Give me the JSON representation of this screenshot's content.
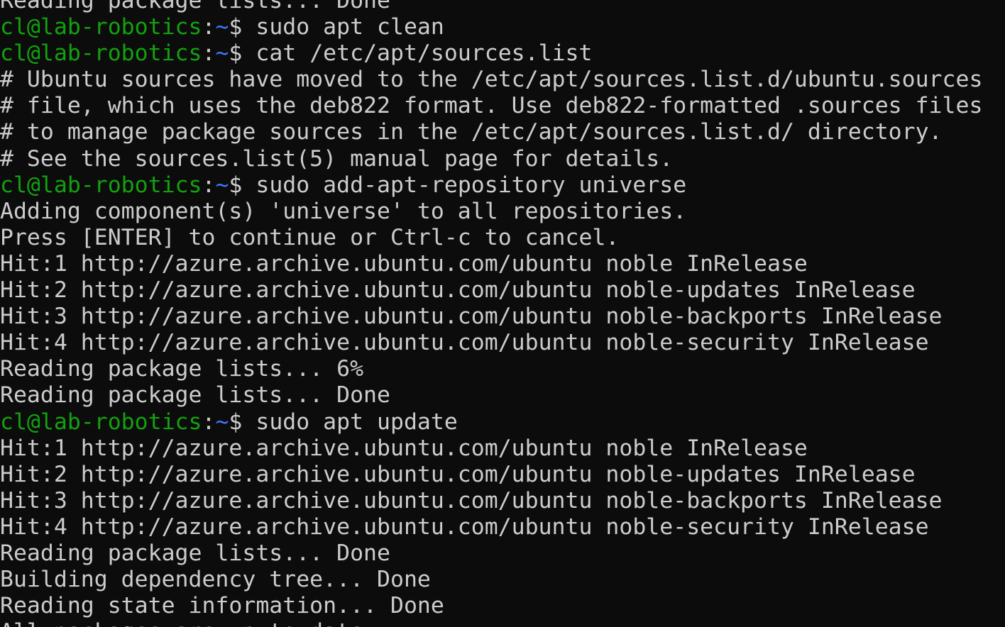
{
  "terminal": {
    "lines": [
      {
        "type": "output",
        "text": "Reading package lists... Done"
      },
      {
        "type": "prompt",
        "user_host": "cl@lab-robotics",
        "sep": ":",
        "path": "~",
        "prompt_char": "$ ",
        "command": "sudo apt clean"
      },
      {
        "type": "prompt",
        "user_host": "cl@lab-robotics",
        "sep": ":",
        "path": "~",
        "prompt_char": "$ ",
        "command": "cat /etc/apt/sources.list"
      },
      {
        "type": "output",
        "text": "# Ubuntu sources have moved to the /etc/apt/sources.list.d/ubuntu.sources"
      },
      {
        "type": "output",
        "text": "# file, which uses the deb822 format. Use deb822-formatted .sources files"
      },
      {
        "type": "output",
        "text": "# to manage package sources in the /etc/apt/sources.list.d/ directory."
      },
      {
        "type": "output",
        "text": "# See the sources.list(5) manual page for details."
      },
      {
        "type": "prompt",
        "user_host": "cl@lab-robotics",
        "sep": ":",
        "path": "~",
        "prompt_char": "$ ",
        "command": "sudo add-apt-repository universe"
      },
      {
        "type": "output",
        "text": "Adding component(s) 'universe' to all repositories."
      },
      {
        "type": "output",
        "text": "Press [ENTER] to continue or Ctrl-c to cancel."
      },
      {
        "type": "output",
        "text": "Hit:1 http://azure.archive.ubuntu.com/ubuntu noble InRelease"
      },
      {
        "type": "output",
        "text": "Hit:2 http://azure.archive.ubuntu.com/ubuntu noble-updates InRelease"
      },
      {
        "type": "output",
        "text": "Hit:3 http://azure.archive.ubuntu.com/ubuntu noble-backports InRelease"
      },
      {
        "type": "output",
        "text": "Hit:4 http://azure.archive.ubuntu.com/ubuntu noble-security InRelease"
      },
      {
        "type": "output",
        "text": "Reading package lists... 6%"
      },
      {
        "type": "output",
        "text": "Reading package lists... Done"
      },
      {
        "type": "prompt",
        "user_host": "cl@lab-robotics",
        "sep": ":",
        "path": "~",
        "prompt_char": "$ ",
        "command": "sudo apt update"
      },
      {
        "type": "output",
        "text": "Hit:1 http://azure.archive.ubuntu.com/ubuntu noble InRelease"
      },
      {
        "type": "output",
        "text": "Hit:2 http://azure.archive.ubuntu.com/ubuntu noble-updates InRelease"
      },
      {
        "type": "output",
        "text": "Hit:3 http://azure.archive.ubuntu.com/ubuntu noble-backports InRelease"
      },
      {
        "type": "output",
        "text": "Hit:4 http://azure.archive.ubuntu.com/ubuntu noble-security InRelease"
      },
      {
        "type": "output",
        "text": "Reading package lists... Done"
      },
      {
        "type": "output",
        "text": "Building dependency tree... Done"
      },
      {
        "type": "output",
        "text": "Reading state information... Done"
      },
      {
        "type": "output",
        "text": "All packages are up to date."
      }
    ]
  },
  "colors": {
    "background": "#0c0c0c",
    "foreground": "#cccccc",
    "prompt_user": "#13a10e",
    "prompt_path": "#3b78ff"
  }
}
